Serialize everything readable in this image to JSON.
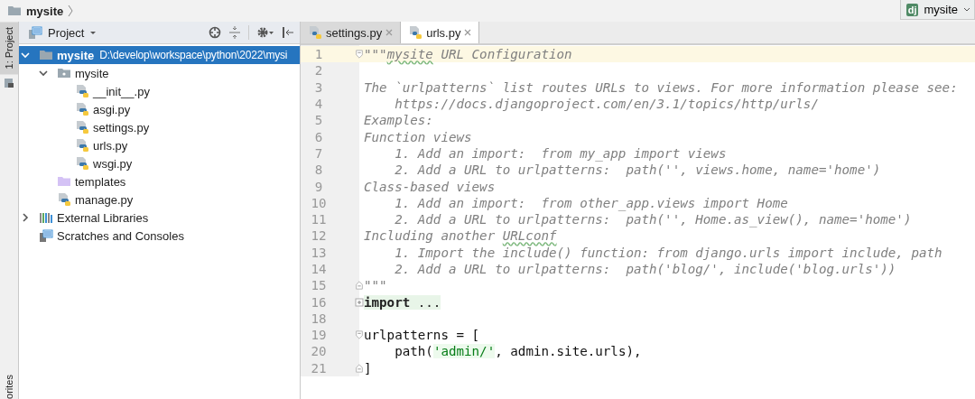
{
  "breadcrumb": {
    "label": "mysite"
  },
  "run_config": {
    "logo": "dj",
    "label": "mysite"
  },
  "side_strip": {
    "top_tab": "1: Project",
    "bottom_tab": "orites"
  },
  "project_panel": {
    "title": "Project",
    "tree": [
      {
        "label": "mysite",
        "path": "D:\\develop\\workspace\\python\\2022\\mysi",
        "kind": "folder",
        "selected": true,
        "expanded": true,
        "children": [
          {
            "label": "mysite",
            "kind": "package",
            "selected": false,
            "expanded": true,
            "children": [
              {
                "label": "__init__.py",
                "kind": "python",
                "selected": false
              },
              {
                "label": "asgi.py",
                "kind": "python",
                "selected": false
              },
              {
                "label": "settings.py",
                "kind": "python",
                "selected": false
              },
              {
                "label": "urls.py",
                "kind": "python",
                "selected": false
              },
              {
                "label": "wsgi.py",
                "kind": "python",
                "selected": false
              }
            ]
          },
          {
            "label": "templates",
            "kind": "templates",
            "selected": false
          },
          {
            "label": "manage.py",
            "kind": "python",
            "selected": false
          }
        ]
      },
      {
        "label": "External Libraries",
        "kind": "library",
        "selected": false,
        "expanded": false
      },
      {
        "label": "Scratches and Consoles",
        "kind": "scratches",
        "selected": false
      }
    ]
  },
  "editor": {
    "tabs": [
      {
        "label": "settings.py",
        "selected": false
      },
      {
        "label": "urls.py",
        "selected": true
      }
    ],
    "lines": [
      {
        "number": "1",
        "kind": "fold-start",
        "current": true,
        "segments": [
          {
            "t": "\"\"\"",
            "kind": "doc"
          },
          {
            "t": "mysite",
            "kind": "doc-typo"
          },
          {
            "t": " URL Configuration",
            "kind": "doc"
          }
        ]
      },
      {
        "number": "2",
        "kind": "plain",
        "current": false
      },
      {
        "number": "3",
        "kind": "plain",
        "current": false,
        "segments": [
          {
            "t": "The `urlpatterns` list routes URLs to views. For more information please see:",
            "kind": "doc"
          }
        ]
      },
      {
        "number": "4",
        "kind": "plain",
        "current": false,
        "segments": [
          {
            "t": "    https://docs.djangoproject.com/en/3.1/topics/http/urls/",
            "kind": "doc"
          }
        ]
      },
      {
        "number": "5",
        "kind": "plain",
        "current": false,
        "segments": [
          {
            "t": "Examples:",
            "kind": "doc"
          }
        ]
      },
      {
        "number": "6",
        "kind": "plain",
        "current": false,
        "segments": [
          {
            "t": "Function views",
            "kind": "doc"
          }
        ]
      },
      {
        "number": "7",
        "kind": "plain",
        "current": false,
        "segments": [
          {
            "t": "    1. Add an import:  from my_app import views",
            "kind": "doc"
          }
        ]
      },
      {
        "number": "8",
        "kind": "plain",
        "current": false,
        "segments": [
          {
            "t": "    2. Add a URL to urlpatterns:  path('', views.home, name='home')",
            "kind": "doc"
          }
        ]
      },
      {
        "number": "9",
        "kind": "plain",
        "current": false,
        "segments": [
          {
            "t": "Class-based views",
            "kind": "doc"
          }
        ]
      },
      {
        "number": "10",
        "kind": "plain",
        "current": false,
        "segments": [
          {
            "t": "    1. Add an import:  from other_app.views import Home",
            "kind": "doc"
          }
        ]
      },
      {
        "number": "11",
        "kind": "plain",
        "current": false,
        "segments": [
          {
            "t": "    2. Add a URL to urlpatterns:  path('', Home.as_view(), name='home')",
            "kind": "doc"
          }
        ]
      },
      {
        "number": "12",
        "kind": "plain",
        "current": false,
        "segments": [
          {
            "t": "Including another ",
            "kind": "doc"
          },
          {
            "t": "URLconf",
            "kind": "doc-typo"
          }
        ]
      },
      {
        "number": "13",
        "kind": "plain",
        "current": false,
        "segments": [
          {
            "t": "    1. Import the include() function: from django.urls import include, path",
            "kind": "doc"
          }
        ]
      },
      {
        "number": "14",
        "kind": "plain",
        "current": false,
        "segments": [
          {
            "t": "    2. Add a URL to urlpatterns:  path('blog/', include('blog.urls'))",
            "kind": "doc"
          }
        ]
      },
      {
        "number": "15",
        "kind": "fold-end",
        "current": false,
        "segments": [
          {
            "t": "\"\"\"",
            "kind": "doc"
          }
        ]
      },
      {
        "number": "16",
        "kind": "fold-collapsed",
        "current": false,
        "segments": [
          {
            "t": "import",
            "kind": "kw-folded"
          },
          {
            "t": " ...",
            "kind": "folded"
          }
        ]
      },
      {
        "number": "18",
        "kind": "plain",
        "current": false
      },
      {
        "number": "19",
        "kind": "fold-start",
        "current": false,
        "segments": [
          {
            "t": "urlpatterns = [",
            "kind": "plain"
          }
        ]
      },
      {
        "number": "20",
        "kind": "plain",
        "current": false,
        "segments": [
          {
            "t": "    path(",
            "kind": "plain"
          },
          {
            "t": "'admin/'",
            "kind": "string"
          },
          {
            "t": ", admin.site.urls),",
            "kind": "plain"
          }
        ]
      },
      {
        "number": "21",
        "kind": "fold-end",
        "current": false,
        "segments": [
          {
            "t": "]",
            "kind": "plain"
          }
        ]
      }
    ]
  }
}
